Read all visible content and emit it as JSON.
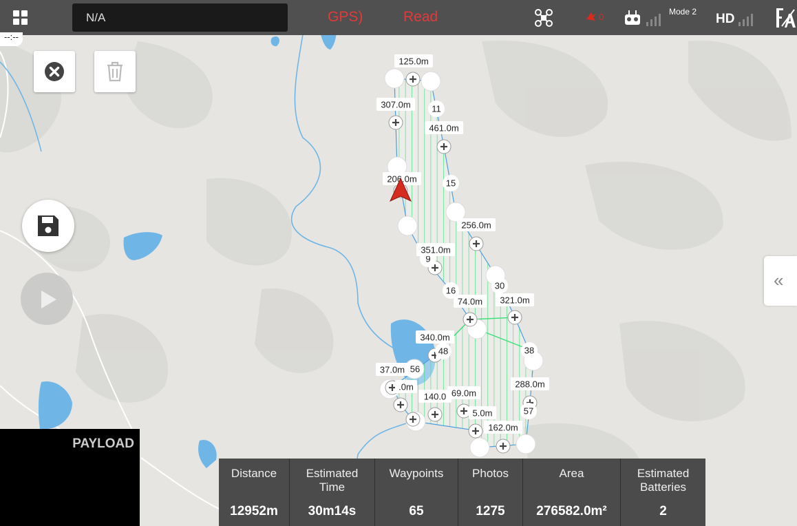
{
  "status": {
    "text": "N/A",
    "gps_warning": "GPS)",
    "ready_warning": "Read"
  },
  "time_readout": "--:--",
  "topbar": {
    "mode": "Mode 2",
    "hd": "HD",
    "flight_warning_count": "0"
  },
  "payload": {
    "title": "PAYLOAD"
  },
  "mission": {
    "distance_labels": [
      "125.0m",
      "307.0m",
      "461.0m",
      "206.0m",
      "256.0m",
      "351.0m",
      "74.0m",
      "321.0m",
      "340.0m",
      "37.0m",
      ".0m",
      "140.0",
      "69.0m",
      "5.0m",
      "162.0m",
      "288.0m"
    ],
    "waypoint_numbers": [
      "11",
      "15",
      "9",
      "16",
      "30",
      "38",
      "48",
      "56",
      "57"
    ]
  },
  "stats": [
    {
      "label": "Distance",
      "value": "12952m"
    },
    {
      "label": "Estimated Time",
      "value": "30m14s"
    },
    {
      "label": "Waypoints",
      "value": "65"
    },
    {
      "label": "Photos",
      "value": "1275"
    },
    {
      "label": "Area",
      "value": "276582.0m²"
    },
    {
      "label": "Estimated Batteries",
      "value": "2"
    }
  ],
  "colors": {
    "route": "#2ecc71",
    "hatch": "#3ee07a",
    "water": "#6fb6e6",
    "heading": "#d62b1f"
  }
}
